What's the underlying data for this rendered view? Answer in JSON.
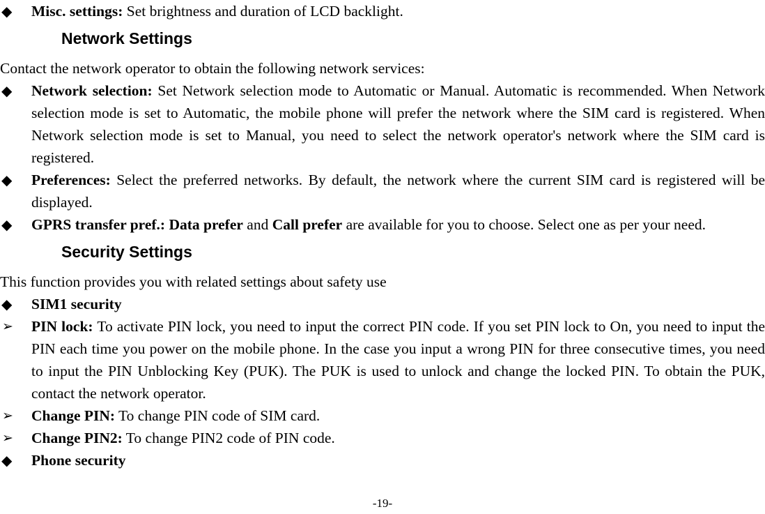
{
  "document": {
    "page_number_label": "-19-",
    "bullet_diamond": "◆",
    "bullet_arrow": "➢"
  },
  "blocks": {
    "misc_settings": {
      "term": "Misc. settings:",
      "text": " Set brightness and duration of LCD backlight."
    },
    "network_settings_heading": "Network Settings",
    "network_intro": "Contact the network operator to obtain the following network services:",
    "network_selection": {
      "term": "Network selection:",
      "text": " Set Network selection mode to Automatic or Manual. Automatic is recommended. When Network selection mode is set to Automatic, the mobile phone will prefer the network where the SIM card is registered. When Network selection mode is set to Manual, you need to select the network operator's network where the SIM card is registered."
    },
    "preferences": {
      "term": "Preferences:",
      "text": " Select the preferred networks. By default, the network where the current SIM card is registered will be displayed."
    },
    "gprs_transfer": {
      "term": "GPRS transfer pref.:",
      "bold_1": "Data prefer",
      "mid": " and ",
      "bold_2": "Call prefer",
      "text": " are available for you to choose. Select one as per your need."
    },
    "security_settings_heading": "Security Settings",
    "security_intro": "This function provides you with related settings about safety use",
    "sim1_security": "SIM1 security",
    "pin_lock": {
      "term": "PIN lock:",
      "text": " To activate PIN lock, you need to input the correct PIN code. If you set PIN lock to On, you need to input the PIN each time you power on the mobile phone. In the case you input a wrong PIN for three consecutive times, you need to input the PIN Unblocking Key (PUK). The PUK is used to unlock and change the locked PIN. To obtain the PUK, contact the network operator."
    },
    "change_pin": {
      "term": "Change PIN:",
      "text": " To change PIN code of SIM card."
    },
    "change_pin2": {
      "term": "Change PIN2:",
      "text": " To change PIN2 code of PIN code."
    },
    "phone_security": "Phone security"
  }
}
